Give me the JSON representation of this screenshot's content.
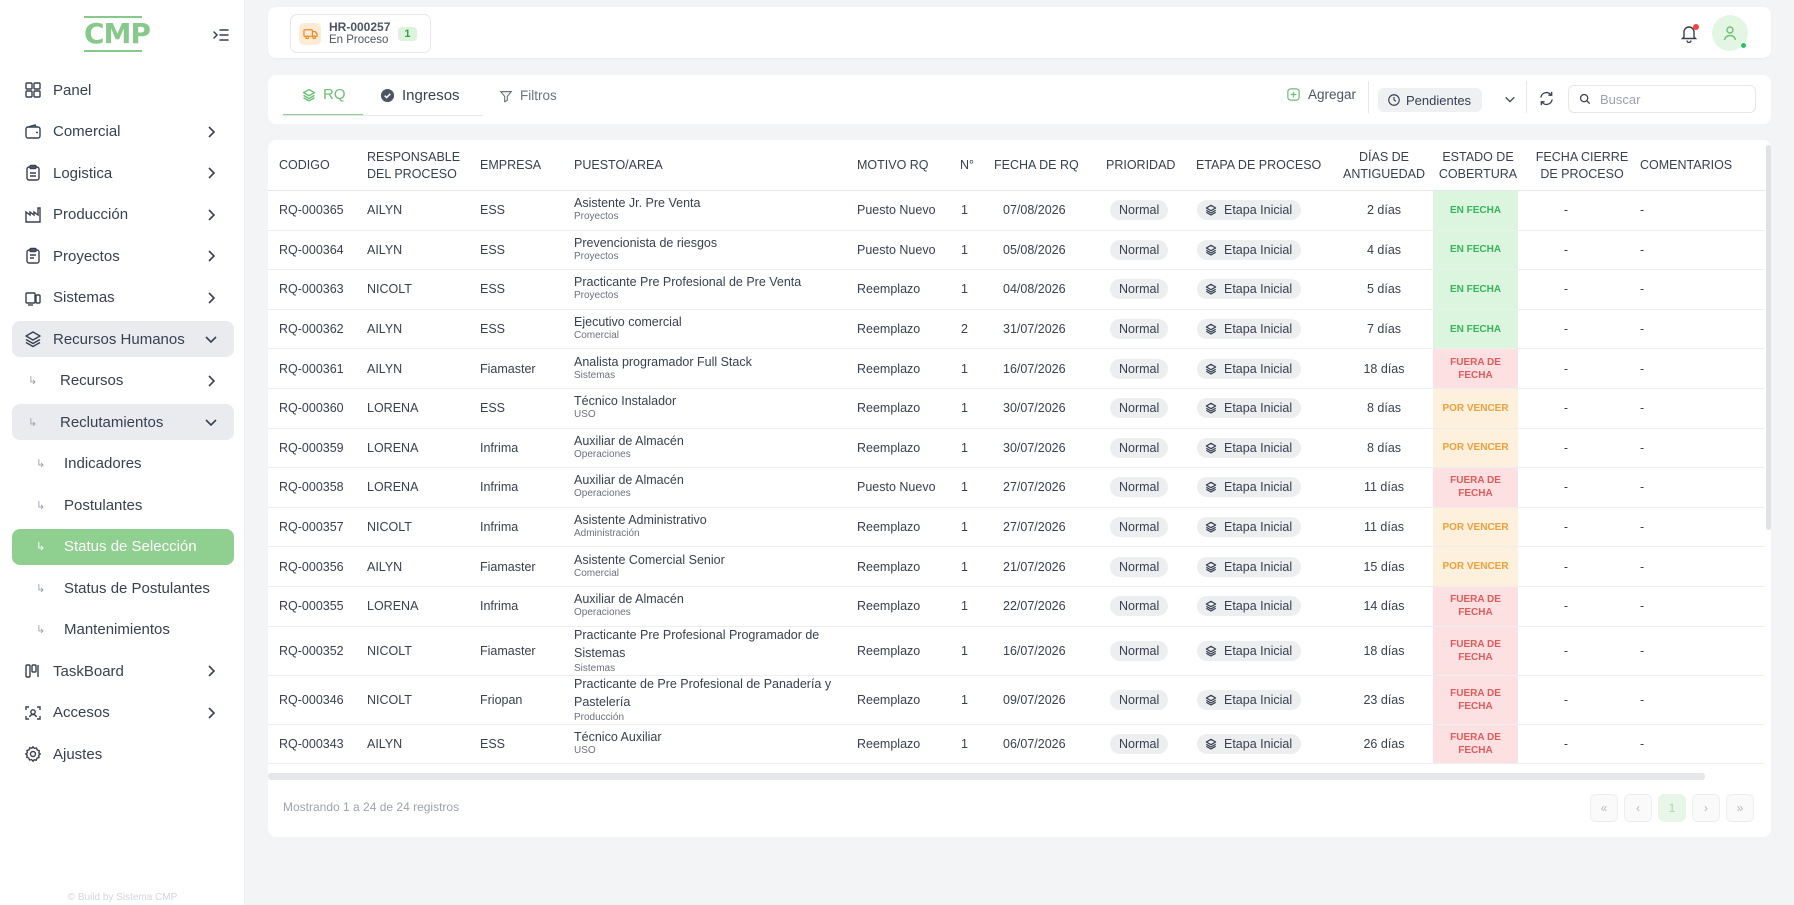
{
  "app": {
    "logo_text": "CMP",
    "build_text": "© Build by Sistema CMP"
  },
  "sidebar": {
    "items": [
      {
        "label": "Panel"
      },
      {
        "label": "Comercial"
      },
      {
        "label": "Logistica"
      },
      {
        "label": "Producción"
      },
      {
        "label": "Proyectos"
      },
      {
        "label": "Sistemas"
      },
      {
        "label": "Recursos Humanos"
      },
      {
        "label": "Recursos"
      },
      {
        "label": "Reclutamientos"
      },
      {
        "label": "Indicadores"
      },
      {
        "label": "Postulantes"
      },
      {
        "label": "Status de Selección"
      },
      {
        "label": "Status de Postulantes"
      },
      {
        "label": "Mantenimientos"
      },
      {
        "label": "TaskBoard"
      },
      {
        "label": "Accesos"
      },
      {
        "label": "Ajustes"
      }
    ]
  },
  "header": {
    "code": "HR-000257",
    "status": "En Proceso",
    "count": "1"
  },
  "toolbar": {
    "tab_rq": "RQ",
    "tab_ingresos": "Ingresos",
    "tab_filtros": "Filtros",
    "agregar": "Agregar",
    "pendientes": "Pendientes",
    "search_placeholder": "Buscar"
  },
  "colors": {
    "accent": "#8fd090",
    "en_fecha": "#35b55a",
    "fuera_de_fecha": "#e05b5b",
    "por_vencer": "#f0a03a"
  },
  "table": {
    "headers": {
      "codigo": "CODIGO",
      "responsable": "RESPONSABLE DEL PROCESO",
      "empresa": "EMPRESA",
      "puesto": "PUESTO/AREA",
      "motivo": "MOTIVO RQ",
      "n": "N°",
      "fecha": "FECHA DE RQ",
      "prioridad": "PRIORIDAD",
      "etapa": "ETAPA DE PROCESO",
      "dias": "DÍAS DE ANTIGUEDAD",
      "estado": "ESTADO DE COBERTURA",
      "cierre": "FECHA CIERRE DE PROCESO",
      "comentarios": "COMENTARIOS"
    },
    "rows": [
      {
        "codigo": "RQ-000365",
        "responsable": "AILYN",
        "empresa": "ESS",
        "puesto": "Asistente Jr. Pre Venta",
        "area": "Proyectos",
        "motivo": "Puesto Nuevo",
        "n": "1",
        "fecha": "07/08/2026",
        "prioridad": "Normal",
        "etapa": "Etapa Inicial",
        "dias": "2 días",
        "estado": "EN FECHA",
        "estado_type": "green",
        "cierre": "-",
        "comentarios": "-"
      },
      {
        "codigo": "RQ-000364",
        "responsable": "AILYN",
        "empresa": "ESS",
        "puesto": "Prevencionista de riesgos",
        "area": "Proyectos",
        "motivo": "Puesto Nuevo",
        "n": "1",
        "fecha": "05/08/2026",
        "prioridad": "Normal",
        "etapa": "Etapa Inicial",
        "dias": "4 días",
        "estado": "EN FECHA",
        "estado_type": "green",
        "cierre": "-",
        "comentarios": "-"
      },
      {
        "codigo": "RQ-000363",
        "responsable": "NICOLT",
        "empresa": "ESS",
        "puesto": "Practicante Pre Profesional de Pre Venta",
        "area": "Proyectos",
        "motivo": "Reemplazo",
        "n": "1",
        "fecha": "04/08/2026",
        "prioridad": "Normal",
        "etapa": "Etapa Inicial",
        "dias": "5 días",
        "estado": "EN FECHA",
        "estado_type": "green",
        "cierre": "-",
        "comentarios": "-"
      },
      {
        "codigo": "RQ-000362",
        "responsable": "AILYN",
        "empresa": "ESS",
        "puesto": "Ejecutivo comercial",
        "area": "Comercial",
        "motivo": "Reemplazo",
        "n": "2",
        "fecha": "31/07/2026",
        "prioridad": "Normal",
        "etapa": "Etapa Inicial",
        "dias": "7 días",
        "estado": "EN FECHA",
        "estado_type": "green",
        "cierre": "-",
        "comentarios": "-"
      },
      {
        "codigo": "RQ-000361",
        "responsable": "AILYN",
        "empresa": "Fiamaster",
        "puesto": "Analista programador Full Stack",
        "area": "Sistemas",
        "motivo": "Reemplazo",
        "n": "1",
        "fecha": "16/07/2026",
        "prioridad": "Normal",
        "etapa": "Etapa Inicial",
        "dias": "18 días",
        "estado": "FUERA DE FECHA",
        "estado_type": "red",
        "cierre": "-",
        "comentarios": "-"
      },
      {
        "codigo": "RQ-000360",
        "responsable": "LORENA",
        "empresa": "ESS",
        "puesto": "Técnico Instalador",
        "area": "USO",
        "motivo": "Reemplazo",
        "n": "1",
        "fecha": "30/07/2026",
        "prioridad": "Normal",
        "etapa": "Etapa Inicial",
        "dias": "8 días",
        "estado": "POR VENCER",
        "estado_type": "orange",
        "cierre": "-",
        "comentarios": "-"
      },
      {
        "codigo": "RQ-000359",
        "responsable": "LORENA",
        "empresa": "Infrima",
        "puesto": "Auxiliar de Almacén",
        "area": "Operaciones",
        "motivo": "Reemplazo",
        "n": "1",
        "fecha": "30/07/2026",
        "prioridad": "Normal",
        "etapa": "Etapa Inicial",
        "dias": "8 días",
        "estado": "POR VENCER",
        "estado_type": "orange",
        "cierre": "-",
        "comentarios": "-"
      },
      {
        "codigo": "RQ-000358",
        "responsable": "LORENA",
        "empresa": "Infrima",
        "puesto": "Auxiliar de Almacén",
        "area": "Operaciones",
        "motivo": "Puesto Nuevo",
        "n": "1",
        "fecha": "27/07/2026",
        "prioridad": "Normal",
        "etapa": "Etapa Inicial",
        "dias": "11 días",
        "estado": "FUERA DE FECHA",
        "estado_type": "red",
        "cierre": "-",
        "comentarios": "-"
      },
      {
        "codigo": "RQ-000357",
        "responsable": "NICOLT",
        "empresa": "Infrima",
        "puesto": "Asistente Administrativo",
        "area": "Administración",
        "motivo": "Reemplazo",
        "n": "1",
        "fecha": "27/07/2026",
        "prioridad": "Normal",
        "etapa": "Etapa Inicial",
        "dias": "11 días",
        "estado": "POR VENCER",
        "estado_type": "orange",
        "cierre": "-",
        "comentarios": "-"
      },
      {
        "codigo": "RQ-000356",
        "responsable": "AILYN",
        "empresa": "Fiamaster",
        "puesto": "Asistente Comercial Senior",
        "area": "Comercial",
        "motivo": "Reemplazo",
        "n": "1",
        "fecha": "21/07/2026",
        "prioridad": "Normal",
        "etapa": "Etapa Inicial",
        "dias": "15 días",
        "estado": "POR VENCER",
        "estado_type": "orange",
        "cierre": "-",
        "comentarios": "-"
      },
      {
        "codigo": "RQ-000355",
        "responsable": "LORENA",
        "empresa": "Infrima",
        "puesto": "Auxiliar de Almacén",
        "area": "Operaciones",
        "motivo": "Reemplazo",
        "n": "1",
        "fecha": "22/07/2026",
        "prioridad": "Normal",
        "etapa": "Etapa Inicial",
        "dias": "14 días",
        "estado": "FUERA DE FECHA",
        "estado_type": "red",
        "cierre": "-",
        "comentarios": "-"
      },
      {
        "codigo": "RQ-000352",
        "responsable": "NICOLT",
        "empresa": "Fiamaster",
        "puesto": "Practicante Pre Profesional Programador de Sistemas",
        "area": "Sistemas",
        "motivo": "Reemplazo",
        "n": "1",
        "fecha": "16/07/2026",
        "prioridad": "Normal",
        "etapa": "Etapa Inicial",
        "dias": "18 días",
        "estado": "FUERA DE FECHA",
        "estado_type": "red",
        "cierre": "-",
        "comentarios": "-",
        "tall": true
      },
      {
        "codigo": "RQ-000346",
        "responsable": "NICOLT",
        "empresa": "Friopan",
        "puesto": "Practicante de Pre Profesional de Panadería y Pastelería",
        "area": "Producción",
        "motivo": "Reemplazo",
        "n": "1",
        "fecha": "09/07/2026",
        "prioridad": "Normal",
        "etapa": "Etapa Inicial",
        "dias": "23 días",
        "estado": "FUERA DE FECHA",
        "estado_type": "red",
        "cierre": "-",
        "comentarios": "-",
        "tall": true
      },
      {
        "codigo": "RQ-000343",
        "responsable": "AILYN",
        "empresa": "ESS",
        "puesto": "Técnico Auxiliar",
        "area": "USO",
        "motivo": "Reemplazo",
        "n": "1",
        "fecha": "06/07/2026",
        "prioridad": "Normal",
        "etapa": "Etapa Inicial",
        "dias": "26 días",
        "estado": "FUERA DE FECHA",
        "estado_type": "red",
        "cierre": "-",
        "comentarios": "-"
      }
    ]
  },
  "footer": {
    "showing": "Mostrando 1 a 24 de 24 registros",
    "first": "«",
    "prev": "‹",
    "page": "1",
    "next": "›",
    "last": "»"
  }
}
